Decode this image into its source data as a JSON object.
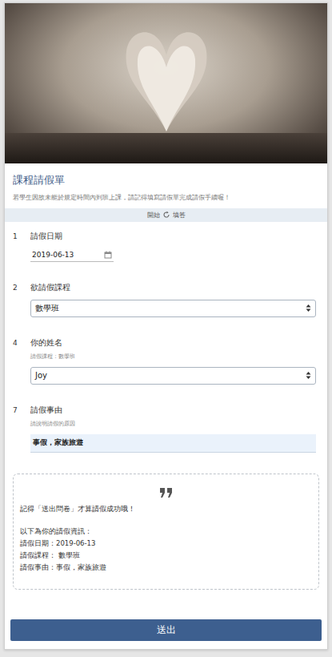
{
  "form": {
    "title": "課程請假單",
    "description": "若學生因故未能於規定時間內到班上課，請記得填寫請假單完成請假手續喔！"
  },
  "start_bar": {
    "before": "開始",
    "after": "填答"
  },
  "questions": [
    {
      "number": "1",
      "label": "請假日期",
      "sublabel": "",
      "kind": "date",
      "value": "2019-06-13"
    },
    {
      "number": "2",
      "label": "欲請假課程",
      "sublabel": "",
      "kind": "select",
      "value": "數學班"
    },
    {
      "number": "4",
      "label": "你的姓名",
      "sublabel": "請假課程：數學班",
      "kind": "select",
      "value": "Joy"
    },
    {
      "number": "7",
      "label": "請假事由",
      "sublabel": "請說明請假的原因",
      "kind": "text",
      "value": "事假，家族旅遊"
    }
  ],
  "summary": {
    "note": "記得「送出問卷」才算請假成功哦！",
    "lines": [
      "以下為你的請假資訊：",
      "請假日期：2019-06-13",
      "請假課程： 數學班",
      "請假事由：事假，家族旅遊"
    ]
  },
  "submit_button": "送出"
}
